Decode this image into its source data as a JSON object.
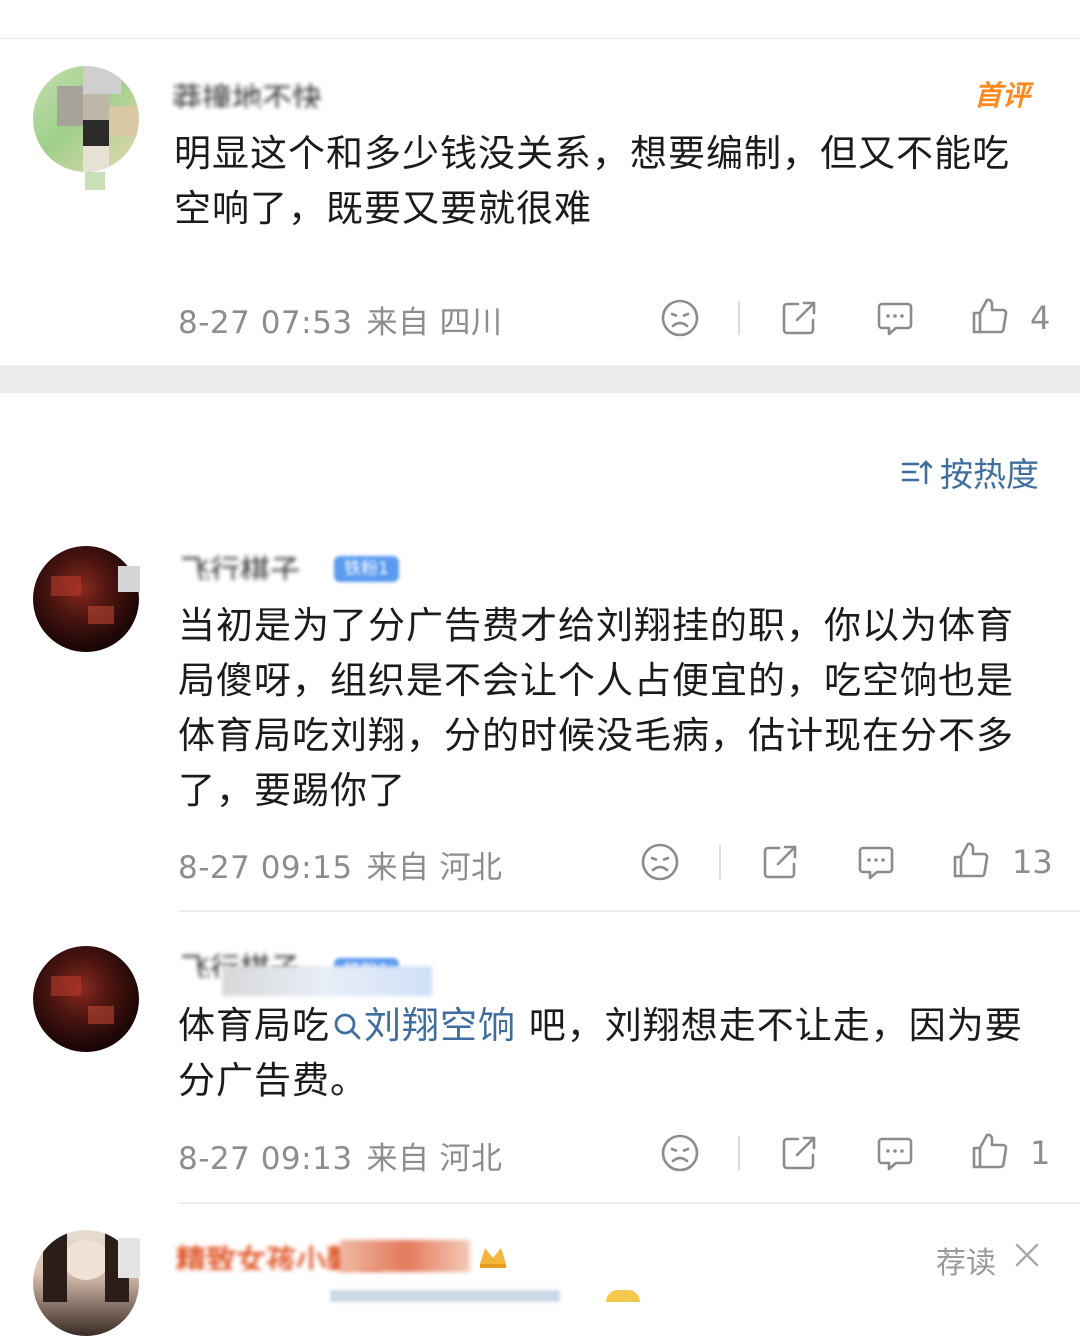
{
  "first_comment": {
    "username": "莽撞地不快",
    "badge": "首评",
    "text": "明显这个和多少钱没关系，想要编制，但又不能吃空响了，既要又要就很难",
    "timestamp": "8-27 07:53",
    "location_label": "来自",
    "location": "四川",
    "likes": "4"
  },
  "sort": {
    "icon": "sort-icon",
    "label": "按热度"
  },
  "comments": [
    {
      "username": "飞行棋子",
      "fan_badge": "铁粉1",
      "text": "当初是为了分广告费才给刘翔挂的职，你以为体育局傻呀，组织是不会让个人占便宜的，吃空饷也是体育局吃刘翔，分的时候没毛病，估计现在分不多了，要踢你了",
      "timestamp": "8-27 09:15",
      "location_label": "来自",
      "location": "河北",
      "likes": "13"
    },
    {
      "username": "飞行棋子",
      "fan_badge": "铁粉1",
      "text_before": "体育局吃",
      "topic": "刘翔空饷",
      "text_after": " 吧，刘翔想走不让走，因为要分广告费。",
      "timestamp": "8-27 09:13",
      "location_label": "来自",
      "location": "河北",
      "likes": "1"
    },
    {
      "username": "精致女孩小馨馨",
      "recommend_label": "荐读"
    }
  ],
  "colors": {
    "meta_gray": "#8d8d8d",
    "link_blue": "#3f6e9e",
    "first_badge": "#ff8a1f",
    "fan_badge": "#5b9bf0",
    "separator_band": "#ececec"
  }
}
